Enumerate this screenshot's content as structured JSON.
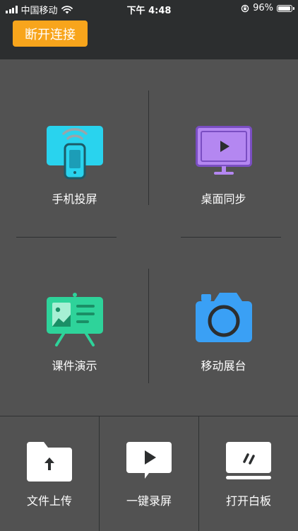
{
  "status_bar": {
    "carrier": "中国移动",
    "time": "下午 4:48",
    "battery": "96%"
  },
  "header": {
    "disconnect_label": "断开连接",
    "accent_color": "#f8a51c"
  },
  "features": [
    {
      "label": "手机投屏",
      "icon": "phone-cast-icon",
      "color": "#29d3ee"
    },
    {
      "label": "桌面同步",
      "icon": "desktop-sync-icon",
      "color": "#b487f1"
    },
    {
      "label": "课件演示",
      "icon": "presentation-board-icon",
      "color": "#2ed39a"
    },
    {
      "label": "移动展台",
      "icon": "camera-icon",
      "color": "#3aa0f5"
    }
  ],
  "bottom_actions": [
    {
      "label": "文件上传",
      "icon": "folder-upload-icon"
    },
    {
      "label": "一键录屏",
      "icon": "screen-record-icon"
    },
    {
      "label": "打开白板",
      "icon": "whiteboard-icon"
    }
  ]
}
